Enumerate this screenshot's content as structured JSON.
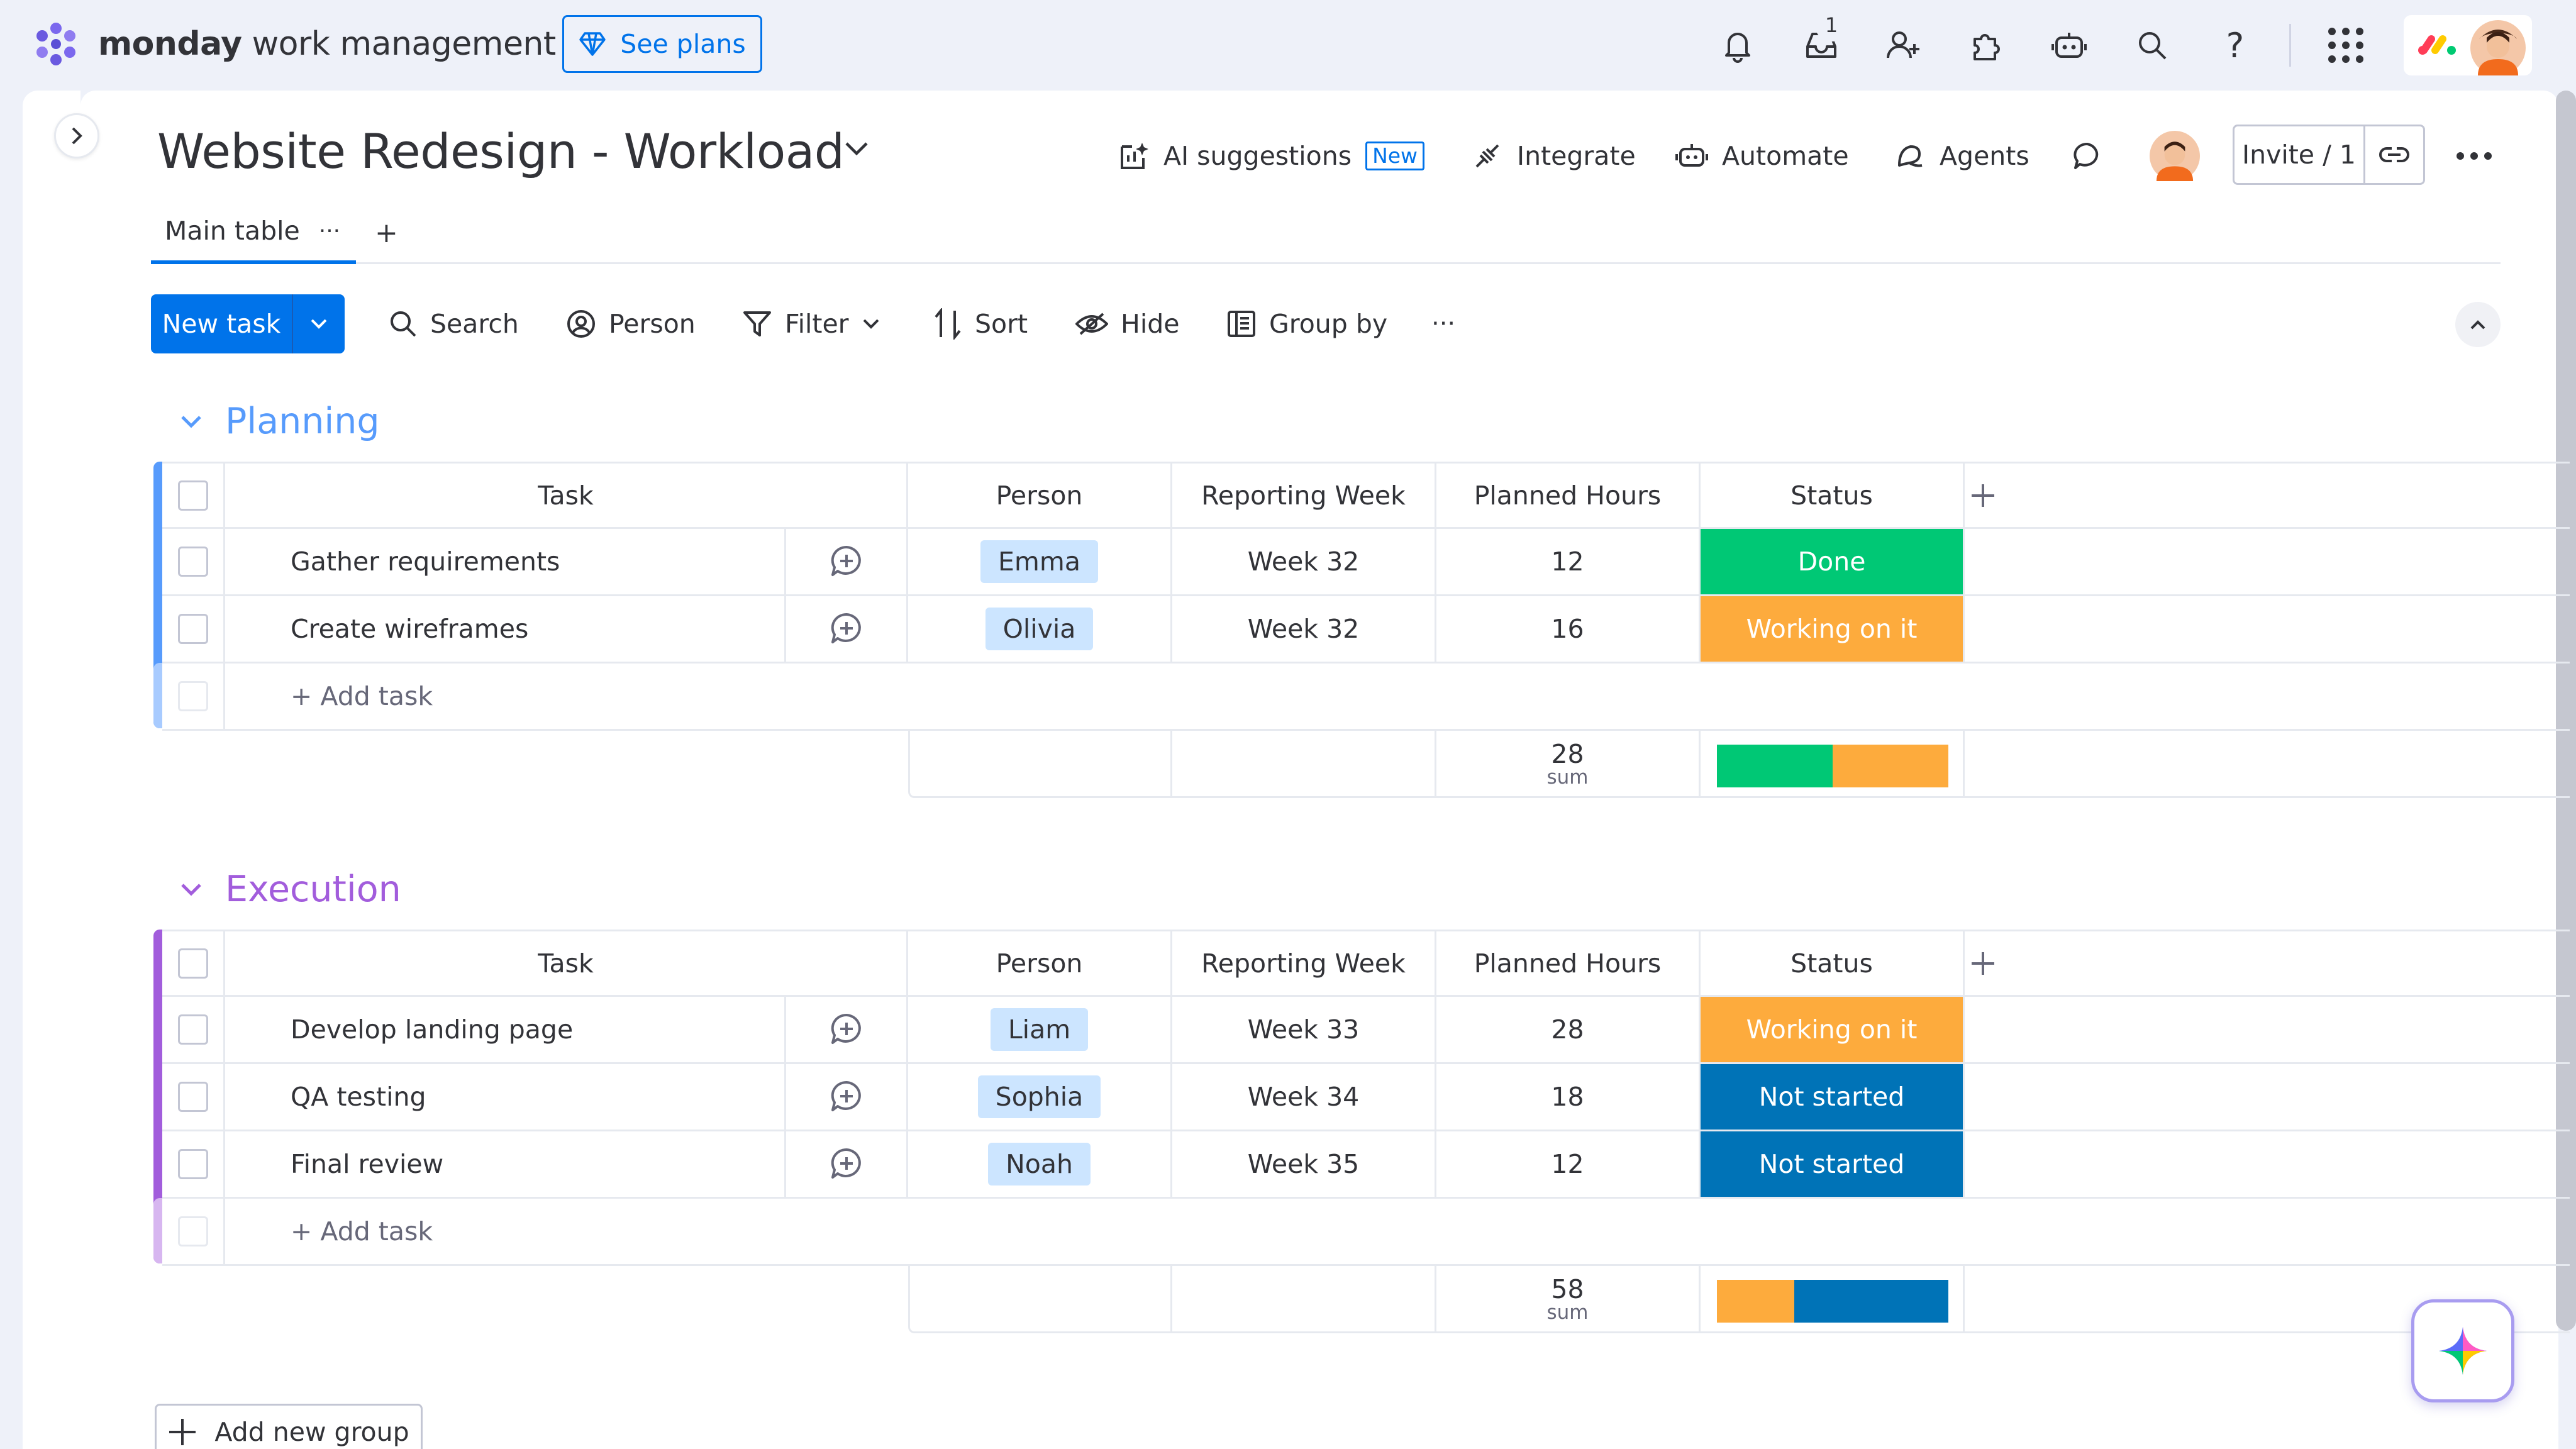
{
  "app": {
    "brand_bold": "monday",
    "brand_rest": " work management",
    "see_plans": "See plans",
    "inbox_badge": "1"
  },
  "icons": {
    "top": [
      "bell-icon",
      "inbox-icon",
      "invite-person-icon",
      "apps-icon",
      "robot-icon",
      "search-icon",
      "help-icon",
      "app-grid-icon"
    ],
    "header": [
      "ai-suggestions-icon",
      "integrate-icon",
      "automate-icon",
      "agents-icon",
      "comment-icon",
      "link-icon",
      "more-icon"
    ]
  },
  "board": {
    "title": "Website Redesign - Workload",
    "actions": {
      "ai": "AI suggestions",
      "ai_badge": "New",
      "integrate": "Integrate",
      "automate": "Automate",
      "agents": "Agents",
      "invite": "Invite / 1"
    },
    "tabs": [
      {
        "label": "Main table",
        "menu": "···"
      }
    ],
    "tab_add": "+"
  },
  "toolbar": {
    "new_task": "New task",
    "search": "Search",
    "person": "Person",
    "filter": "Filter",
    "sort": "Sort",
    "hide": "Hide",
    "group_by": "Group by",
    "more": "···"
  },
  "columns": {
    "task": "Task",
    "person": "Person",
    "week": "Reporting Week",
    "hours": "Planned Hours",
    "status": "Status"
  },
  "status_colors": {
    "Done": "#00c875",
    "Working on it": "#fdab3d",
    "Not started": "#0073b7"
  },
  "groups": [
    {
      "name": "Planning",
      "color": "#579bfc",
      "sum": "28",
      "sum_label": "sum",
      "add_task": "+ Add task",
      "rows": [
        {
          "task": "Gather requirements",
          "person": "Emma",
          "week": "Week 32",
          "hours": "12",
          "status": "Done"
        },
        {
          "task": "Create wireframes",
          "person": "Olivia",
          "week": "Week 32",
          "hours": "16",
          "status": "Working on it"
        }
      ],
      "status_summary": [
        {
          "status": "Done",
          "fraction": 0.5
        },
        {
          "status": "Working on it",
          "fraction": 0.5
        }
      ]
    },
    {
      "name": "Execution",
      "color": "#a25ddc",
      "sum": "58",
      "sum_label": "sum",
      "add_task": "+ Add task",
      "rows": [
        {
          "task": "Develop landing page",
          "person": "Liam",
          "week": "Week 33",
          "hours": "28",
          "status": "Working on it"
        },
        {
          "task": "QA testing",
          "person": "Sophia",
          "week": "Week 34",
          "hours": "18",
          "status": "Not started"
        },
        {
          "task": "Final review",
          "person": "Noah",
          "week": "Week 35",
          "hours": "12",
          "status": "Not started"
        }
      ],
      "status_summary": [
        {
          "status": "Working on it",
          "fraction": 0.333
        },
        {
          "status": "Not started",
          "fraction": 0.667
        }
      ]
    }
  ],
  "add_group": "Add new group"
}
